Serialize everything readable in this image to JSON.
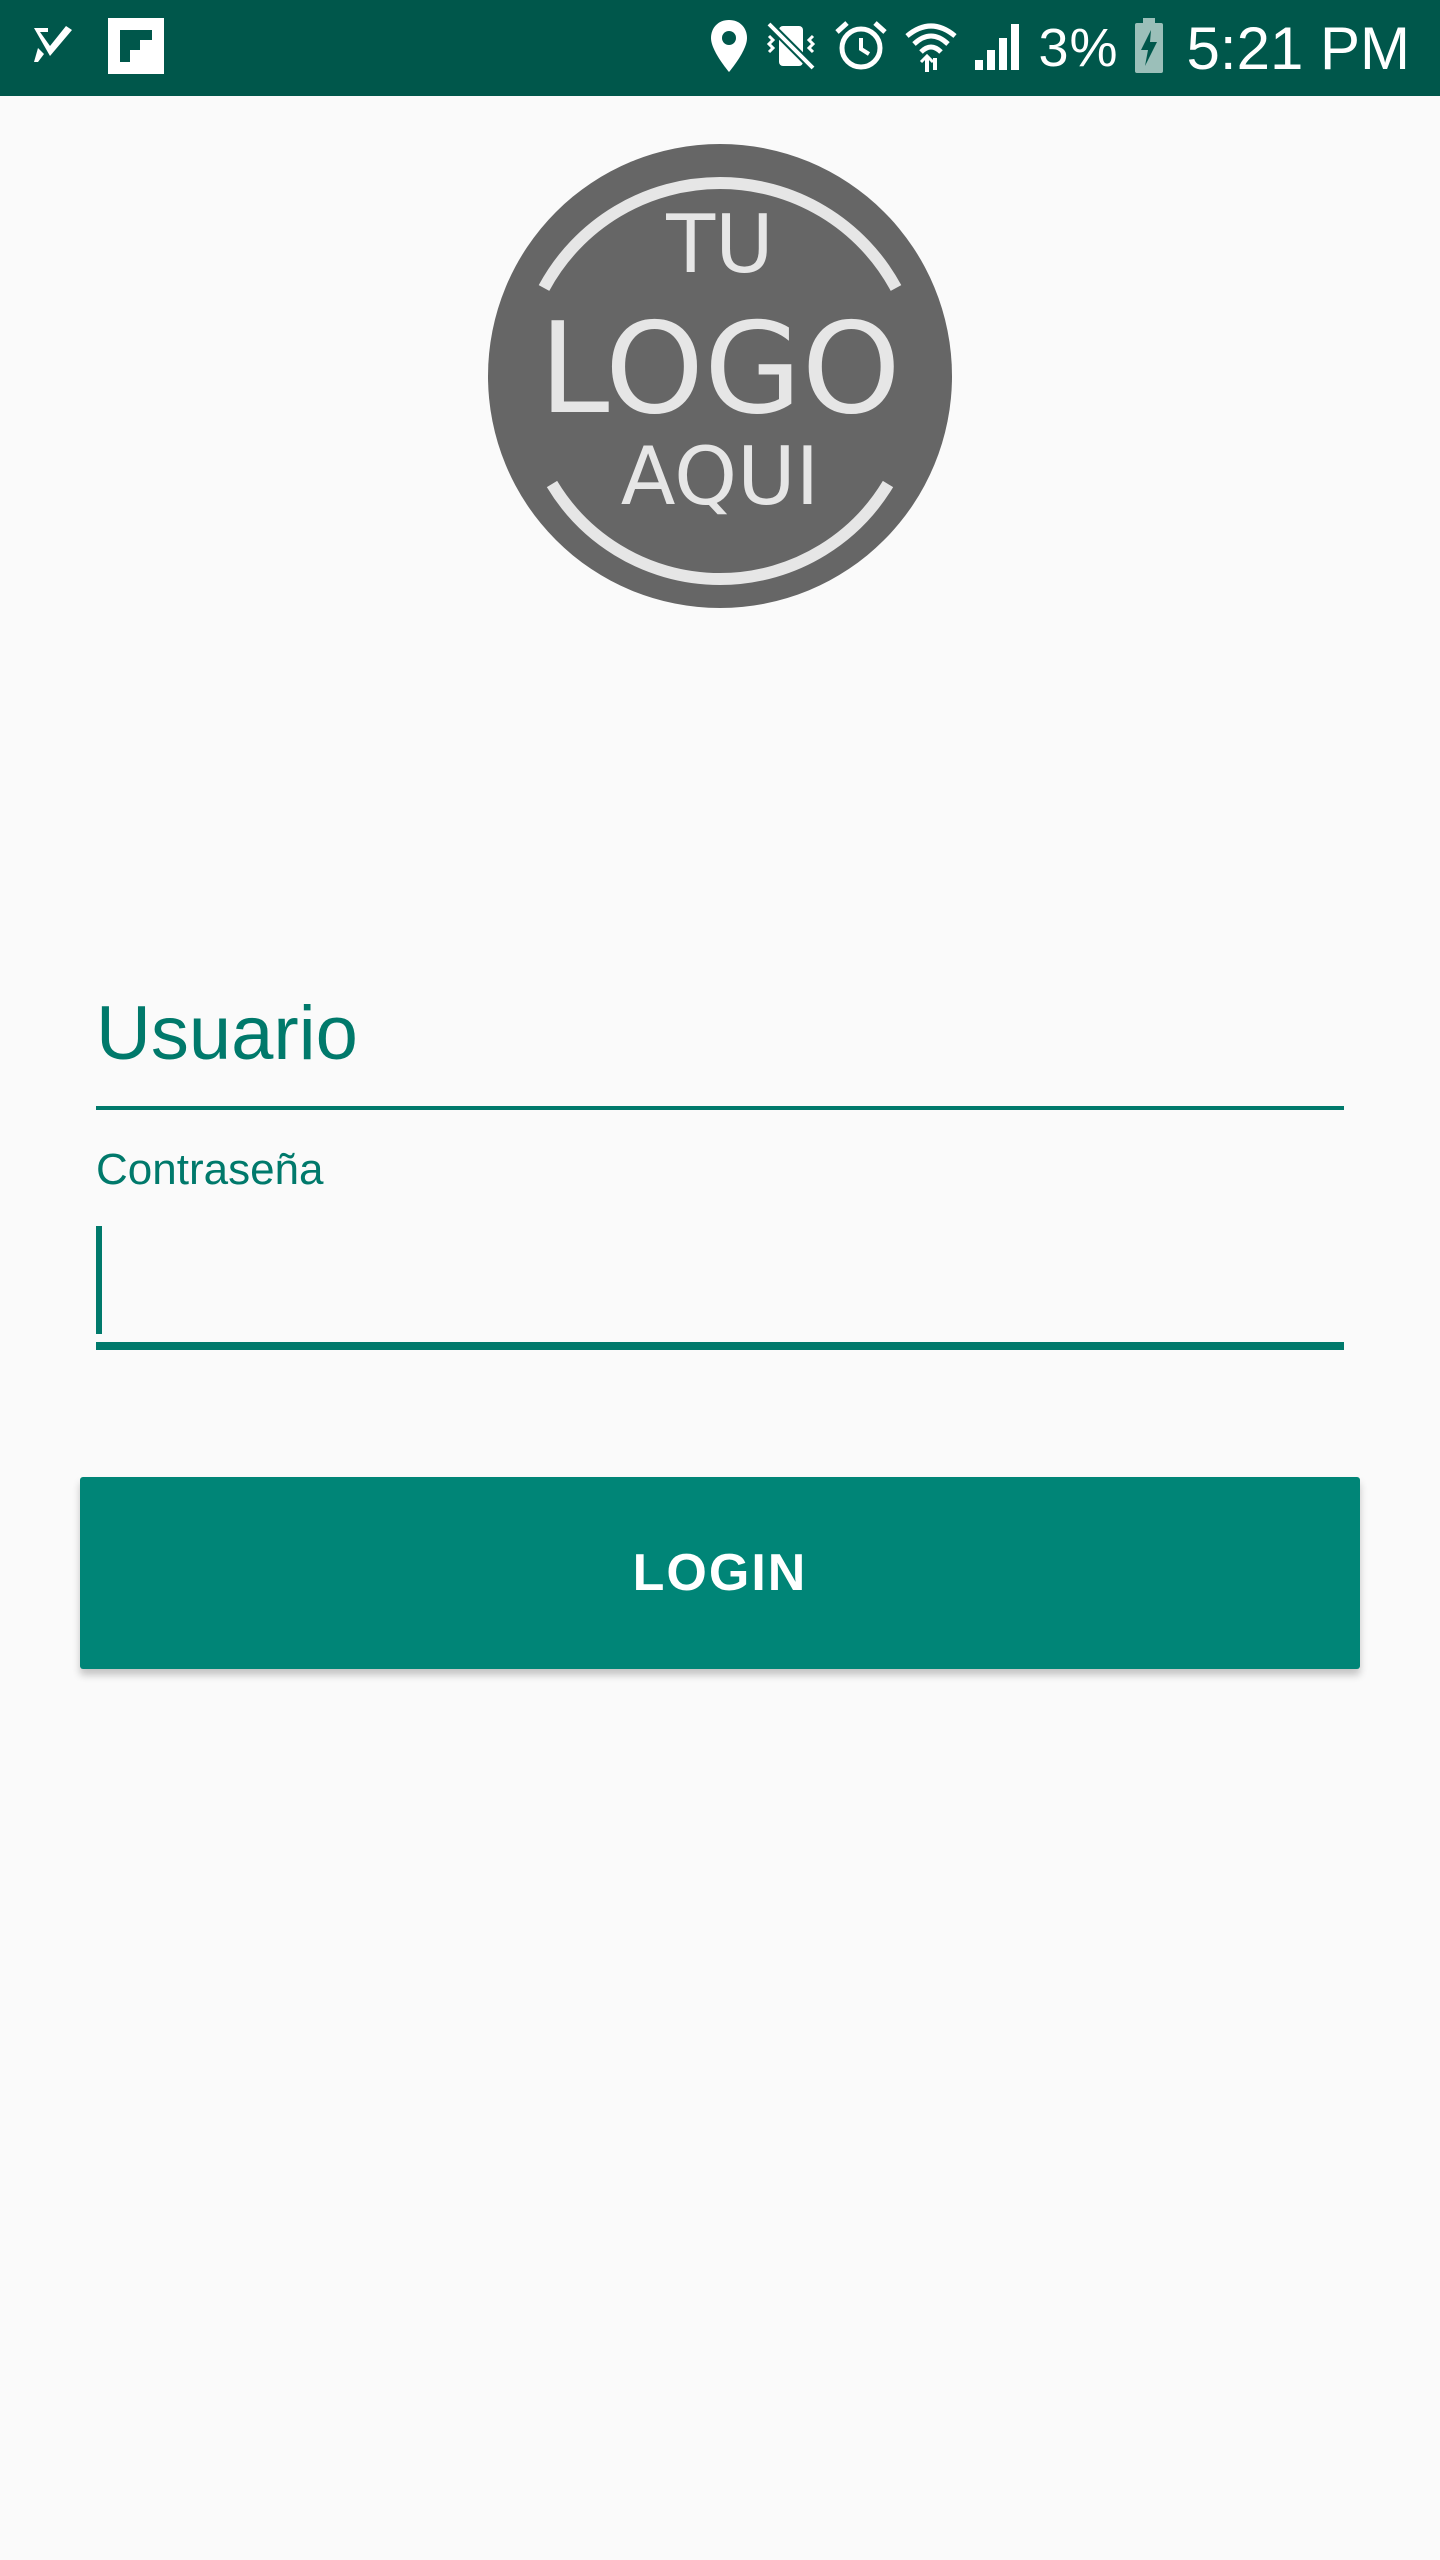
{
  "status_bar": {
    "left_icons": [
      "check-app-icon",
      "flipboard-icon"
    ],
    "right_icons": [
      "location-icon",
      "vibrate-mute-icon",
      "alarm-icon",
      "wifi-icon",
      "signal-icon",
      "battery-icon"
    ],
    "battery_percent": "3%",
    "time": "5:21 PM",
    "background_color": "#00574b"
  },
  "logo": {
    "line1": "TU",
    "line2": "LOGO",
    "line3": "AQUI",
    "circle_color": "#666666",
    "text_color": "#e6e6e6"
  },
  "form": {
    "usuario": "Usuario",
    "password_label": "Contraseña",
    "password_value": "",
    "accent_color": "#00796b"
  },
  "login_button": {
    "label": "LOGIN",
    "color": "#008577"
  }
}
